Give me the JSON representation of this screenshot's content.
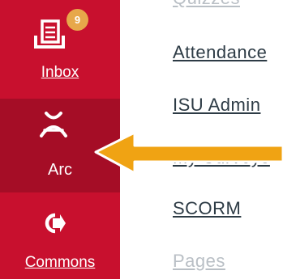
{
  "global_nav": {
    "bg_color": "#c8102e",
    "active_bg_color": "#a50d26",
    "items": [
      {
        "label": "Inbox",
        "icon": "inbox-icon",
        "badge": "9"
      },
      {
        "label": "Arc",
        "icon": "arc-icon",
        "active": true
      },
      {
        "label": "Commons",
        "icon": "commons-icon"
      }
    ]
  },
  "course_nav": {
    "links": [
      {
        "label": "Quizzes",
        "visibility": "faded-partial"
      },
      {
        "label": "Attendance"
      },
      {
        "label": "ISU Admin"
      },
      {
        "label": "My Surveys"
      },
      {
        "label": "SCORM"
      },
      {
        "label": "Pages",
        "visibility": "faded"
      }
    ]
  },
  "annotation": {
    "arrow_color": "#f0a313",
    "points_to": "Arc"
  }
}
